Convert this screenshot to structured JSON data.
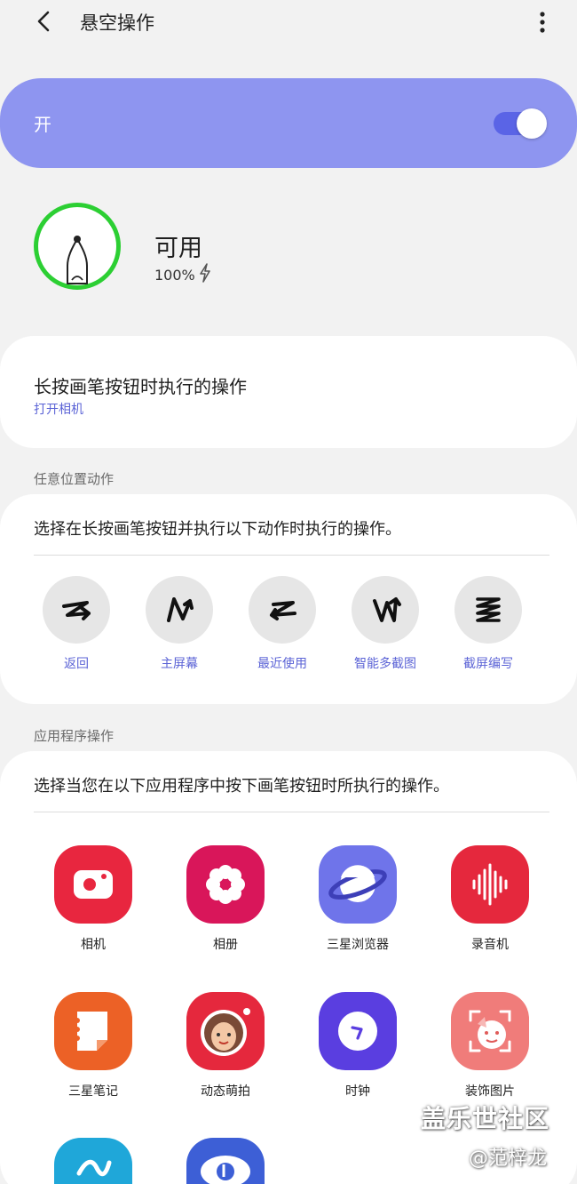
{
  "header": {
    "title": "悬空操作",
    "back_icon": "chevron-left-icon",
    "more_icon": "more-vertical-icon"
  },
  "master_switch": {
    "label": "开",
    "on": true,
    "accent": "#8e95f0",
    "track_color": "#5a64e6"
  },
  "pen_status": {
    "title": "可用",
    "battery": "100%",
    "icon": "s-pen-icon",
    "ring_color": "#2ccf33"
  },
  "long_press": {
    "title": "长按画笔按钮时执行的操作",
    "value": "打开相机"
  },
  "anywhere": {
    "section_label": "任意位置动作",
    "description": "选择在长按画笔按钮并执行以下动作时执行的操作。",
    "gestures": [
      {
        "label": "返回",
        "icon": "gesture-back-icon"
      },
      {
        "label": "主屏幕",
        "icon": "gesture-home-icon"
      },
      {
        "label": "最近使用",
        "icon": "gesture-recent-icon"
      },
      {
        "label": "智能多截图",
        "icon": "gesture-smart-select-icon"
      },
      {
        "label": "截屏编写",
        "icon": "gesture-screen-write-icon"
      }
    ]
  },
  "app_actions": {
    "section_label": "应用程序操作",
    "description": "选择当您在以下应用程序中按下画笔按钮时所执行的操作。",
    "apps": [
      {
        "label": "相机",
        "icon": "camera-app-icon",
        "color": "#e8263f"
      },
      {
        "label": "相册",
        "icon": "gallery-app-icon",
        "color": "#d9165a"
      },
      {
        "label": "三星浏览器",
        "icon": "browser-app-icon",
        "color": "#6f74ea"
      },
      {
        "label": "录音机",
        "icon": "voice-recorder-app-icon",
        "color": "#e5283d"
      },
      {
        "label": "三星笔记",
        "icon": "notes-app-icon",
        "color": "#ec6126"
      },
      {
        "label": "动态萌拍",
        "icon": "ar-emoji-app-icon",
        "color": "#e5283d"
      },
      {
        "label": "时钟",
        "icon": "clock-app-icon",
        "color": "#5a3ee0"
      },
      {
        "label": "装饰图片",
        "icon": "decorate-pictures-app-icon",
        "color": "#f07c7a"
      },
      {
        "label": "",
        "icon": "smart-app-icon",
        "color": "#1fa7d9"
      },
      {
        "label": "",
        "icon": "bixby-vision-app-icon",
        "color": "#3d5fd6"
      }
    ]
  },
  "watermark": {
    "line1": "盖乐世社区",
    "line2": "@范梓龙"
  }
}
